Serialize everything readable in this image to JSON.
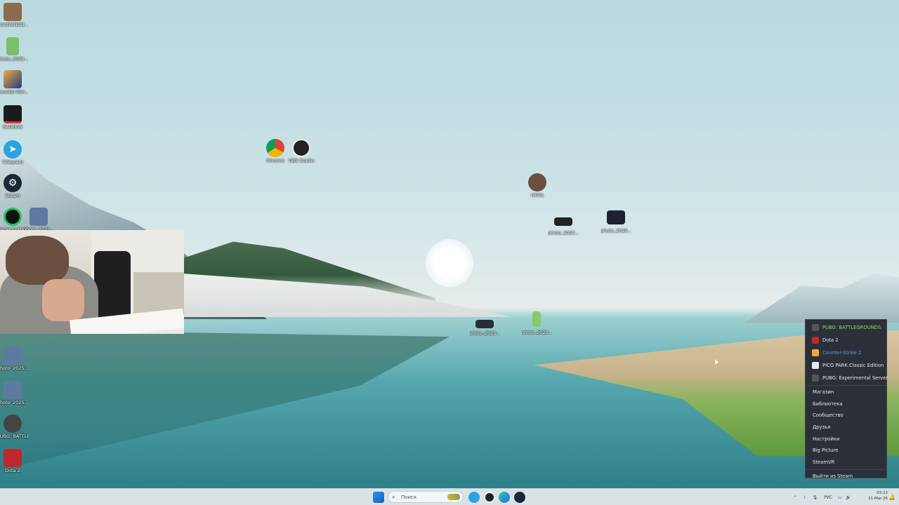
{
  "desktop": {
    "icons_left": [
      {
        "label": "zombieNDG...",
        "icon": "folder-photo-icon",
        "color": "#8c6a4c"
      },
      {
        "label": "photo_2025...",
        "icon": "spreadsheet-file-icon",
        "color": "#7bbf6a"
      },
      {
        "label": "Counter-Stri... 2",
        "icon": "counter-strike-icon",
        "color": "#f2a93b"
      },
      {
        "label": "RADEON",
        "icon": "radeon-icon",
        "color": "#1b1b1b"
      },
      {
        "label": "Telegram",
        "icon": "telegram-icon",
        "color": "#2aa3df"
      },
      {
        "label": "Steam",
        "icon": "steam-icon",
        "color": "#1b2838"
      },
      {
        "label": "Razer Cortex",
        "icon": "razer-cortex-icon",
        "color": "#22c55e"
      },
      {
        "label": "photo_2025...",
        "icon": "image-file-icon",
        "color": "#5d7aa3"
      },
      {
        "label": "photo_2025...",
        "icon": "image-file-icon",
        "color": "#5d7aa3"
      },
      {
        "label": "photo_2025...",
        "icon": "image-file-icon",
        "color": "#5d7aa3"
      },
      {
        "label": "PUBG: BATTLEGRO...",
        "icon": "pubg-icon",
        "color": "#444444"
      },
      {
        "label": "Dota 2",
        "icon": "dota2-icon",
        "color": "#c0262d"
      }
    ],
    "icons_middle": [
      {
        "label": "Chrome",
        "icon": "chrome-icon"
      },
      {
        "label": "OBS Studio",
        "icon": "obs-studio-icon"
      },
      {
        "label": "nikita",
        "icon": "user-folder-icon"
      },
      {
        "label": "photo_2025...",
        "icon": "image-file-icon"
      },
      {
        "label": "photo_2025...",
        "icon": "image-file-icon"
      },
      {
        "label": "photo_2025...",
        "icon": "image-file-icon"
      },
      {
        "label": "photo_2025...",
        "icon": "spreadsheet-file-icon"
      }
    ]
  },
  "steam_menu": {
    "games": [
      {
        "label": "PUBG: BATTLEGROUNDS",
        "color": "#9bd35a",
        "icon": "pubg-icon",
        "icon_color": "#555555"
      },
      {
        "label": "Dota 2",
        "color": "#e6e6e6",
        "icon": "dota2-icon",
        "icon_color": "#c0262d"
      },
      {
        "label": "Counter-Strike 2",
        "color": "#4aa3e0",
        "icon": "counter-strike-icon",
        "icon_color": "#f2a93b"
      },
      {
        "label": "PICO PARK:Classic Edition",
        "color": "#e6e6e6",
        "icon": "pico-park-icon",
        "icon_color": "#e8e8e8"
      },
      {
        "label": "PUBG: Experimental Server",
        "color": "#e6e6e6",
        "icon": "pubg-icon",
        "icon_color": "#555555"
      }
    ],
    "items": [
      "Магазин",
      "Библиотека",
      "Сообщество",
      "Друзья",
      "Настройки",
      "Big Picture",
      "SteamVR",
      "Выйти из Steam"
    ]
  },
  "taskbar": {
    "search_placeholder": "Поиск",
    "apps": [
      "windows-start-icon",
      "telegram-icon",
      "obs-studio-icon",
      "edge-icon",
      "steam-icon"
    ],
    "tray_language": "РУС",
    "time": "03:22",
    "date": "31-Mar-26"
  }
}
